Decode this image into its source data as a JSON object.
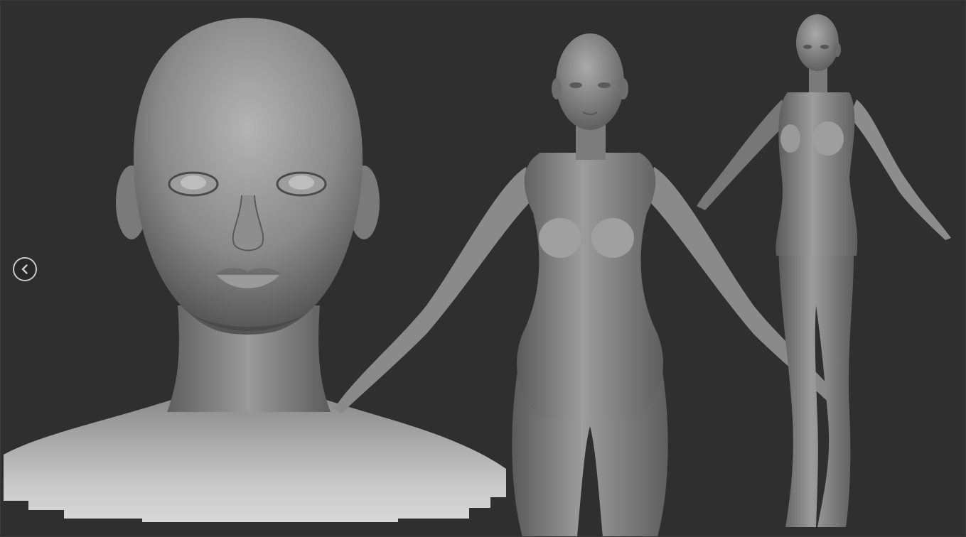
{
  "viewer": {
    "background_color": "#2f2f2f",
    "clay_color": "#8c8c8c"
  },
  "navigation": {
    "prev_icon": "chevron-left-icon"
  },
  "image": {
    "panels": [
      "bust-front-view",
      "full-body-front-view",
      "full-body-three-quarter-view"
    ]
  }
}
